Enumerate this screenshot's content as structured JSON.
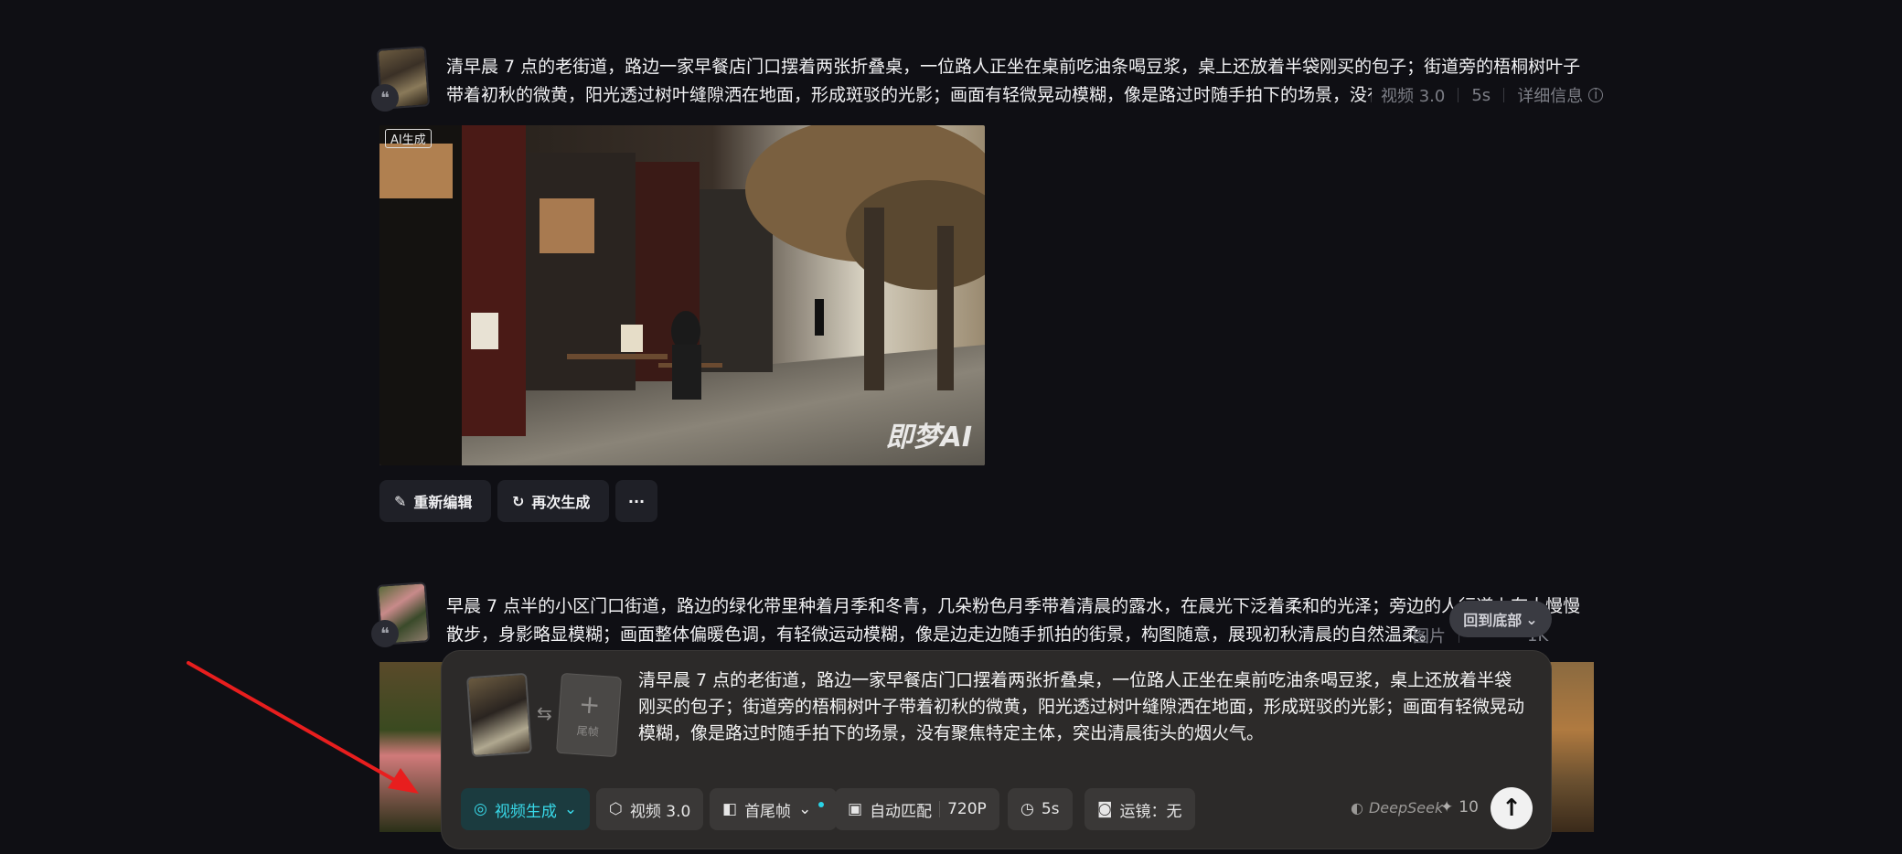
{
  "item1": {
    "prompt": "清早晨 7 点的老街道，路边一家早餐店门口摆着两张折叠桌，一位路人正坐在桌前吃油条喝豆浆，桌上还放着半袋刚买的包子；街道旁的梧桐树叶子带着初秋的微黄，阳光透过树叶缝隙洒在地面，形成斑驳的光影；画面有轻微晃动模糊，像是路过时随手拍下的场景，没有聚焦特定",
    "model": "视频 3.0",
    "duration": "5s",
    "details_label": "详细信息",
    "ai_tag": "AI生成",
    "watermark": "即梦AI",
    "actions": {
      "re_edit": "重新编辑",
      "regenerate": "再次生成",
      "more": "···"
    }
  },
  "item2": {
    "prompt": "早晨 7 点半的小区门口街道，路边的绿化带里种着月季和冬青，几朵粉色月季带着清晨的露水，在晨光下泛着柔和的光泽；旁边的人行道上有人慢慢散步，身影略显模糊；画面整体偏暖色调，有轻微运动模糊，像是边走边随手抓拍的街景，构图随意，展现初秋清晨的自然温柔。",
    "type_label": "图片",
    "resolution": "1K"
  },
  "back_to_bottom": "回到底部",
  "composer": {
    "prompt": "清早晨 7 点的老街道，路边一家早餐店门口摆着两张折叠桌，一位路人正坐在桌前吃油条喝豆浆，桌上还放着半袋刚买的包子；街道旁的梧桐树叶子带着初秋的微黄，阳光透过树叶缝隙洒在地面，形成斑驳的光影；画面有轻微晃动模糊，像是路过时随手拍下的场景，没有聚焦特定主体，突出清晨街头的烟火气。",
    "end_frame_label": "尾帧",
    "toolbar": {
      "mode": "视频生成",
      "model": "视频 3.0",
      "frames": "首尾帧",
      "ratio": "自动匹配",
      "resolution": "720P",
      "duration": "5s",
      "camera": "运镜：无"
    },
    "deepseek_label": "DeepSeek",
    "credits": "10"
  },
  "colors": {
    "background": "#0f0f14",
    "accent": "#38d8e8",
    "annotation_arrow": "#e81e1e"
  }
}
